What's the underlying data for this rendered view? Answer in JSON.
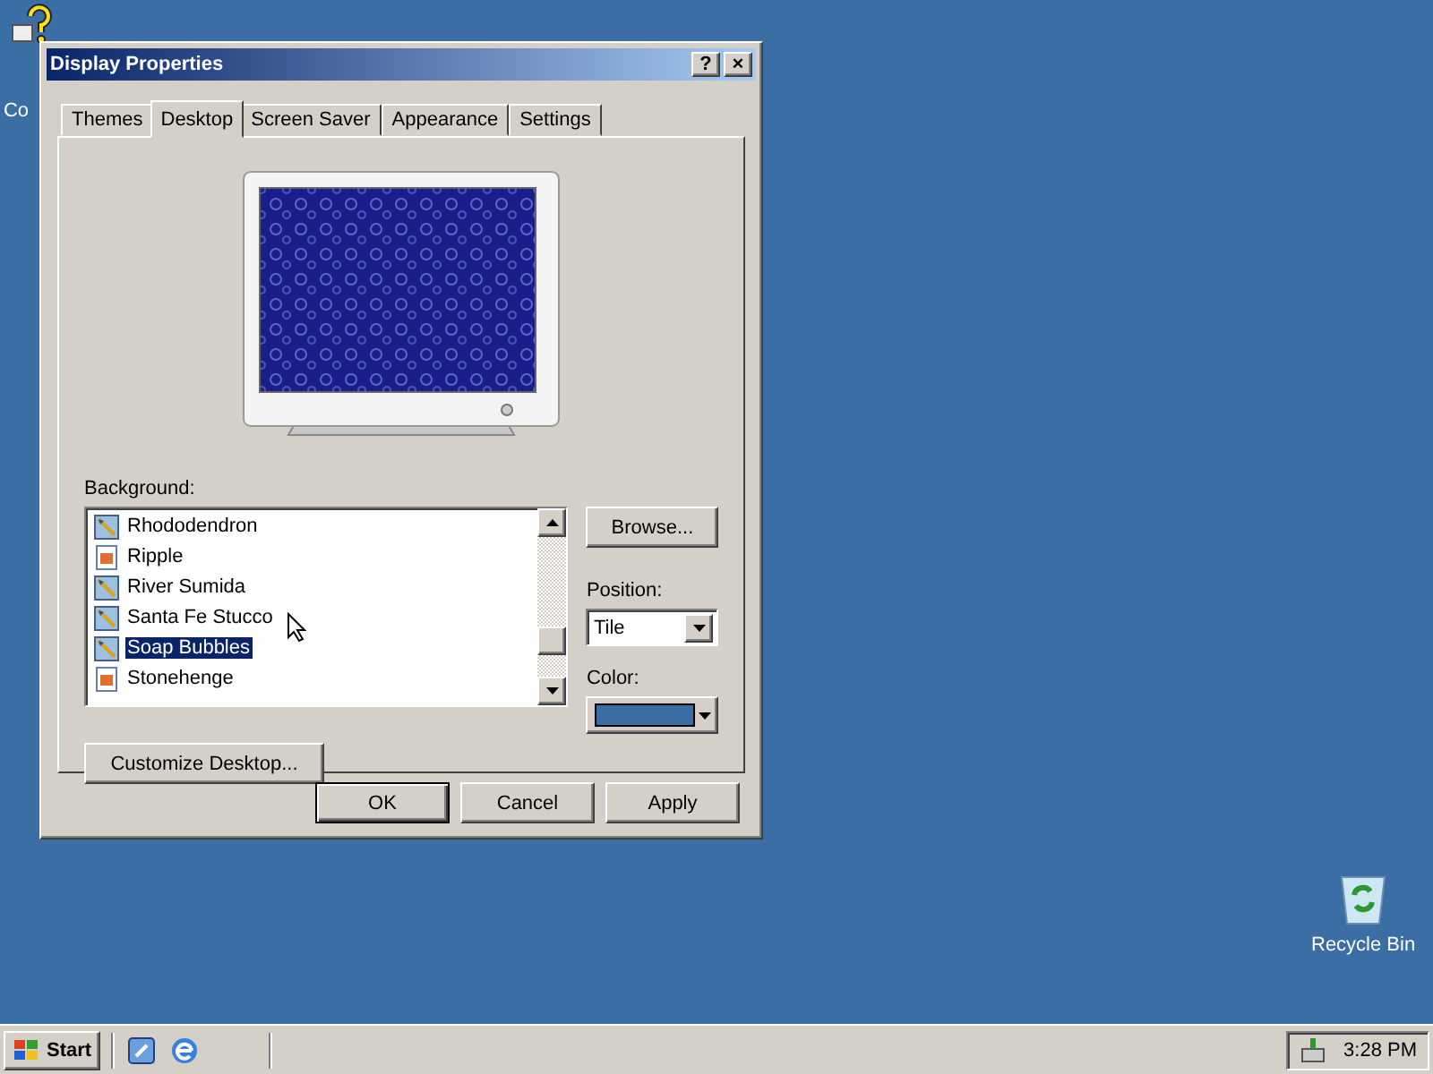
{
  "desktop_icons": [
    {
      "label": "Co",
      "kind": "help"
    },
    {
      "label": "Recycle Bin",
      "kind": "recycle"
    }
  ],
  "window": {
    "title": "Display Properties",
    "title_buttons": [
      "?",
      "×"
    ]
  },
  "tabs": [
    {
      "label": "Themes",
      "selected": false
    },
    {
      "label": "Desktop",
      "selected": true
    },
    {
      "label": "Screen Saver",
      "selected": false
    },
    {
      "label": "Appearance",
      "selected": false
    },
    {
      "label": "Settings",
      "selected": false
    }
  ],
  "background": {
    "label": "Background:",
    "items": [
      {
        "name": "Rhododendron",
        "kind": "image",
        "selected": false
      },
      {
        "name": "Ripple",
        "kind": "html",
        "selected": false
      },
      {
        "name": "River Sumida",
        "kind": "image",
        "selected": false
      },
      {
        "name": "Santa Fe Stucco",
        "kind": "image",
        "selected": false
      },
      {
        "name": "Soap Bubbles",
        "kind": "image",
        "selected": true
      },
      {
        "name": "Stonehenge",
        "kind": "html",
        "selected": false
      }
    ]
  },
  "browse_button": "Browse...",
  "position": {
    "label": "Position:",
    "value": "Tile"
  },
  "color": {
    "label": "Color:",
    "color": "#3a6ea5"
  },
  "customize_button": "Customize Desktop...",
  "dialog_buttons": [
    {
      "label": "OK",
      "default": true
    },
    {
      "label": "Cancel",
      "default": false
    },
    {
      "label": "Apply",
      "default": false
    }
  ],
  "taskbar": {
    "start": "Start",
    "clock": "3:28 PM"
  }
}
